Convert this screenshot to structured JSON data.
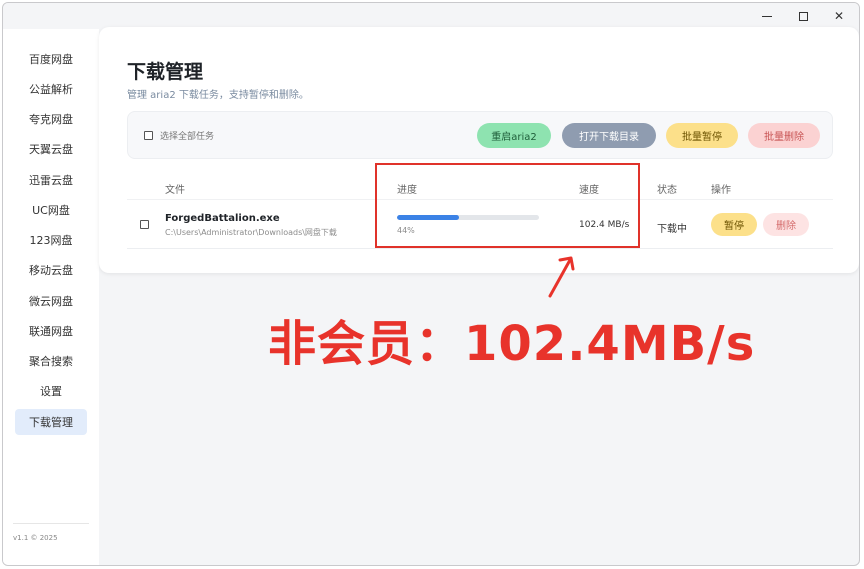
{
  "window": {
    "controls": {
      "minimize": "minimize-icon",
      "maximize": "maximize-icon",
      "close": "✕"
    }
  },
  "sidebar": {
    "items": [
      {
        "label": "百度网盘"
      },
      {
        "label": "公益解析"
      },
      {
        "label": "夸克网盘"
      },
      {
        "label": "天翼云盘"
      },
      {
        "label": "迅雷云盘"
      },
      {
        "label": "UC网盘"
      },
      {
        "label": "123网盘"
      },
      {
        "label": "移动云盘"
      },
      {
        "label": "微云网盘"
      },
      {
        "label": "联通网盘"
      },
      {
        "label": "聚合搜索"
      },
      {
        "label": "设置"
      },
      {
        "label": "下载管理",
        "active": true
      }
    ],
    "footer": "v1.1  © 2025"
  },
  "page": {
    "title": "下载管理",
    "subtitle": "管理 aria2 下载任务，支持暂停和删除。"
  },
  "toolbar": {
    "select_all": "选择全部任务",
    "restart": "重启aria2",
    "open_dir": "打开下载目录",
    "batch_pause": "批量暂停",
    "batch_delete": "批量删除"
  },
  "table": {
    "headers": {
      "file": "文件",
      "progress": "进度",
      "speed": "速度",
      "status": "状态",
      "actions": "操作"
    },
    "rows": [
      {
        "name": "ForgedBattalion.exe",
        "path": "C:\\Users\\Administrator\\Downloads\\网盘下载",
        "progress": 0.44,
        "progress_text": "44%",
        "speed": "102.4 MB/s",
        "status": "下载中",
        "pause": "暂停",
        "delete": "删除"
      }
    ]
  },
  "annotation": {
    "text": "非会员：102.4MB/s",
    "color": "#e8332b"
  }
}
